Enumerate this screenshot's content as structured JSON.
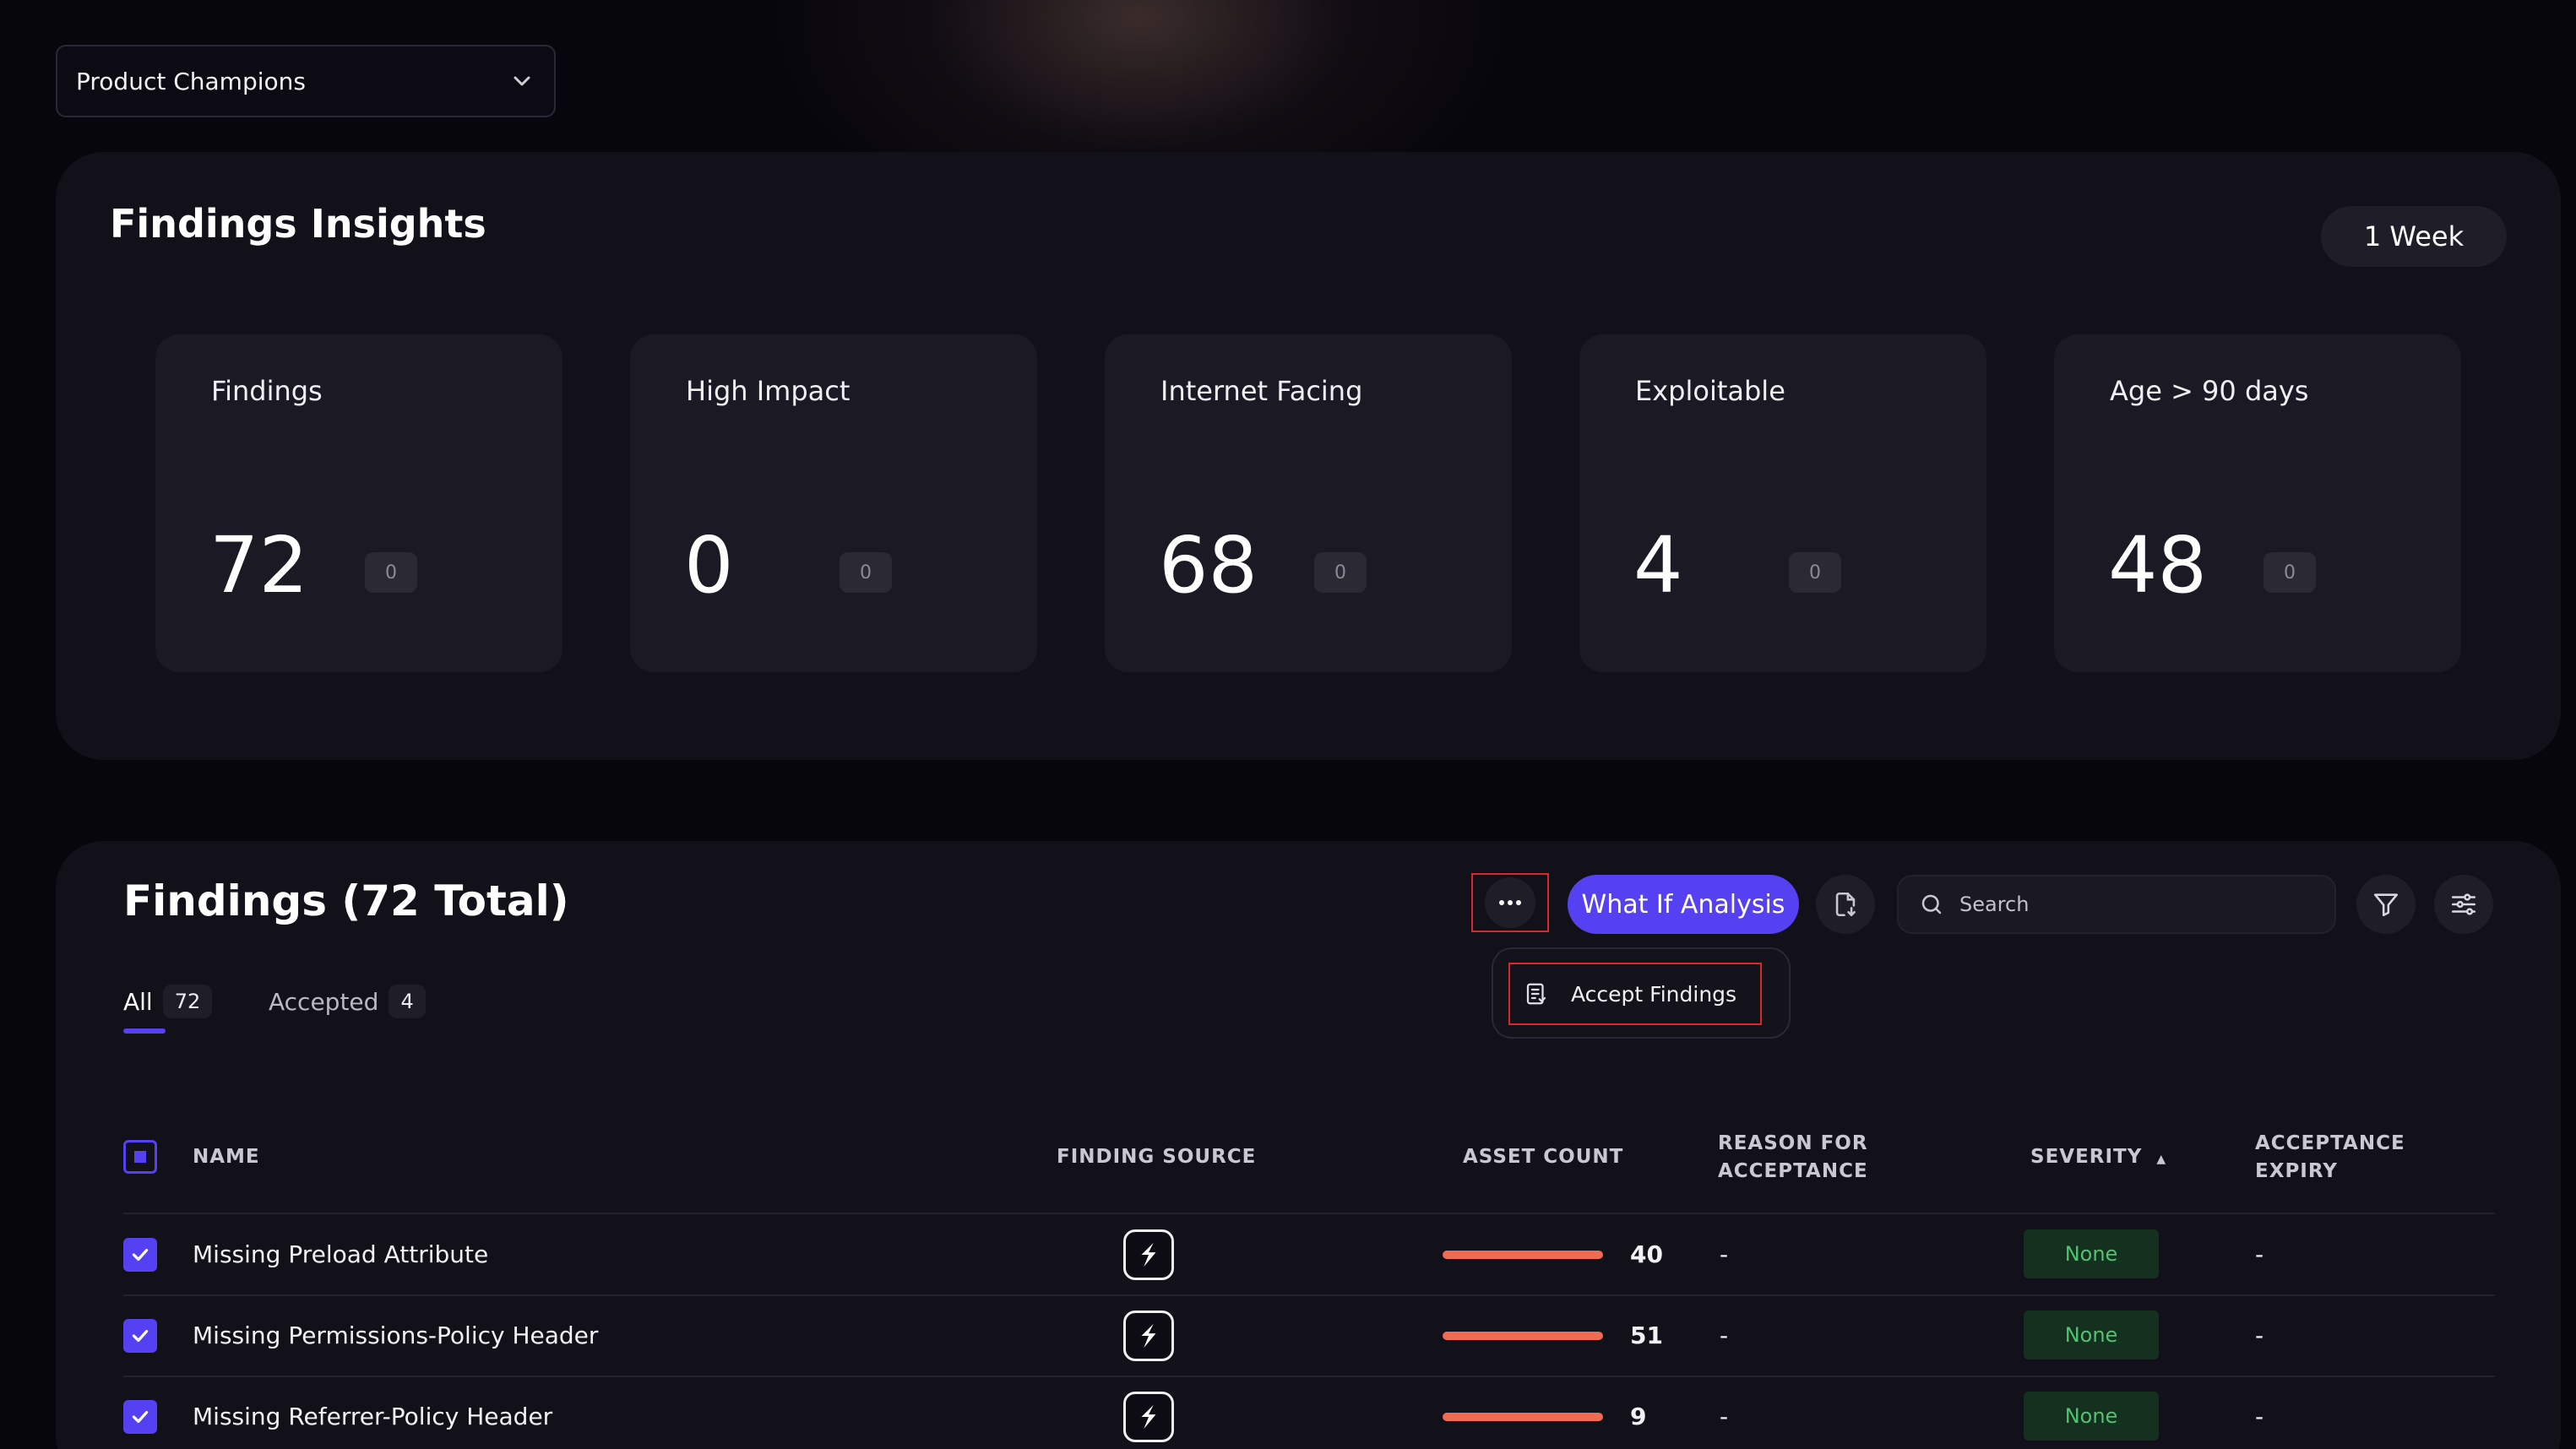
{
  "team_selector": {
    "value": "Product Champions"
  },
  "insights": {
    "title": "Findings Insights",
    "period": "1 Week",
    "metrics": [
      {
        "label": "Findings",
        "value": "72",
        "delta": "0"
      },
      {
        "label": "High Impact",
        "value": "0",
        "delta": "0"
      },
      {
        "label": "Internet Facing",
        "value": "68",
        "delta": "0"
      },
      {
        "label": "Exploitable",
        "value": "4",
        "delta": "0"
      },
      {
        "label": "Age > 90 days",
        "value": "48",
        "delta": "0"
      }
    ]
  },
  "findings": {
    "title": "Findings (72 Total)",
    "what_if_label": "What If Analysis",
    "search_placeholder": "Search",
    "menu": {
      "accept_findings": "Accept Findings"
    },
    "tabs": [
      {
        "label": "All",
        "count": "72"
      },
      {
        "label": "Accepted",
        "count": "4"
      }
    ],
    "columns": {
      "name": "NAME",
      "source": "FINDING SOURCE",
      "asset_count": "ASSET COUNT",
      "reason_1": "REASON FOR",
      "reason_2": "ACCEPTANCE",
      "severity": "SEVERITY",
      "sort_indicator": "▲",
      "expiry_1": "ACCEPTANCE",
      "expiry_2": "EXPIRY"
    },
    "rows": [
      {
        "name": "Missing Preload Attribute",
        "asset_count": "40",
        "reason": "-",
        "severity": "None",
        "expiry": "-"
      },
      {
        "name": "Missing Permissions-Policy Header",
        "asset_count": "51",
        "reason": "-",
        "severity": "None",
        "expiry": "-"
      },
      {
        "name": "Missing Referrer-Policy Header",
        "asset_count": "9",
        "reason": "-",
        "severity": "None",
        "expiry": "-"
      }
    ]
  },
  "colors": {
    "accent": "#5540f2",
    "bar": "#f26a52",
    "severity_none": "#52c170",
    "highlight": "#d8272d"
  }
}
